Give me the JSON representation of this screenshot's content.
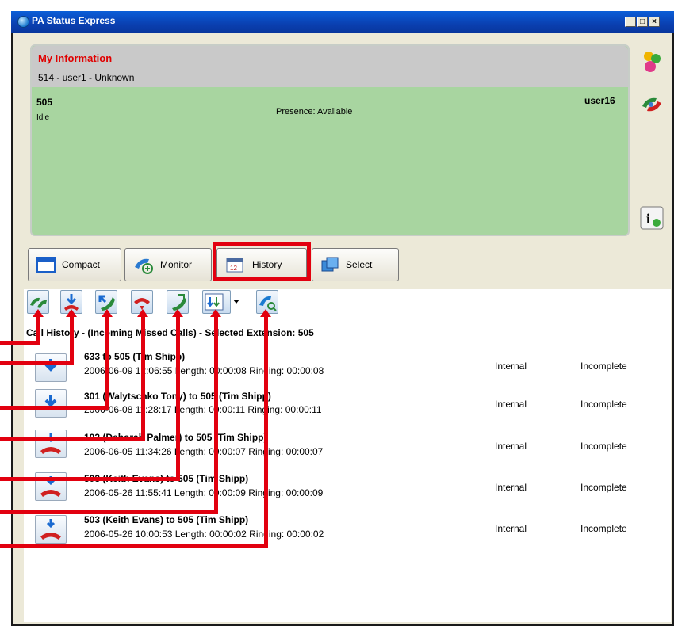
{
  "window": {
    "title": "PA Status Express",
    "controls": {
      "minimize": "_",
      "maximize": "□",
      "close": "×"
    }
  },
  "my_information": {
    "heading": "My Information",
    "user": "514 - user1 - Unknown"
  },
  "extension": {
    "number": "505",
    "state": "Idle",
    "presence": "Presence:  Available",
    "user": "user16"
  },
  "side_icons": [
    "users-icon",
    "phone-transfer-icon",
    "info-icon"
  ],
  "view_buttons": [
    {
      "label": "Compact",
      "icon": "compact-window-icon"
    },
    {
      "label": "Monitor",
      "icon": "monitor-phone-icon"
    },
    {
      "label": "History",
      "icon": "calendar-icon",
      "highlighted": true
    },
    {
      "label": "Select",
      "icon": "select-window-icon"
    }
  ],
  "history_toolbar": [
    "all-calls-icon",
    "incoming-missed-icon",
    "incoming-answered-icon",
    "outgoing-icon",
    "outgoing-answered-icon",
    "filter-dropdown-icon",
    "search-call-icon"
  ],
  "history_caption": "Call History - (Incoming Missed Calls) - Selected Extension: 505",
  "history_rows": [
    {
      "title": "633 to 505 (Tim Shipp)",
      "detail": "2006-06-09 12:06:55 Length: 00:00:08 Ringing: 00:00:08",
      "type": "Internal",
      "status": "Incomplete",
      "icon": "incoming-missed-icon"
    },
    {
      "title": "301 (Walytschko Tony) to 505 (Tim Shipp)",
      "detail": "2006-06-08 11:28:17 Length: 00:00:11 Ringing: 00:00:11",
      "type": "Internal",
      "status": "Incomplete",
      "icon": "incoming-missed-icon"
    },
    {
      "title": "103 (Deborah Palmer) to 505 (Tim Shipp)",
      "detail": "2006-06-05 11:34:26 Length: 00:00:07 Ringing: 00:00:07",
      "type": "Internal",
      "status": "Incomplete",
      "icon": "missed-hangup-icon"
    },
    {
      "title": "503 (Keith Evans) to 505 (Tim Shipp)",
      "detail": "2006-05-26 11:55:41 Length: 00:00:09 Ringing: 00:00:09",
      "type": "Internal",
      "status": "Incomplete",
      "icon": "missed-hangup-icon"
    },
    {
      "title": "503 (Keith Evans) to 505 (Tim Shipp)",
      "detail": "2006-05-26 10:00:53 Length: 00:00:02 Ringing: 00:00:02",
      "type": "Internal",
      "status": "Incomplete",
      "icon": "incoming-missed-icon"
    }
  ],
  "colors": {
    "title_bar": "#0a3fb0",
    "info_panel": "#a8d5a0",
    "annotation": "#e2000f",
    "heading_red": "#e00000"
  }
}
